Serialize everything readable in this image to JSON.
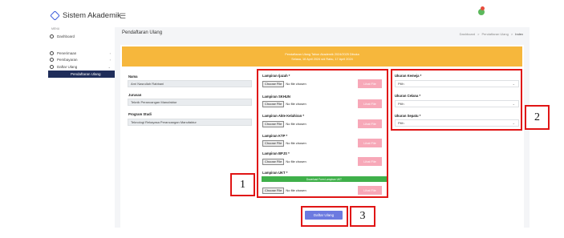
{
  "app": {
    "name": "Sistem Akademik"
  },
  "sidebar": {
    "section_label": "MENU",
    "items": [
      {
        "label": "Dashboard"
      },
      {
        "label": "Penerimaan"
      },
      {
        "label": "Pembayaran"
      },
      {
        "label": "Daftar Ulang"
      }
    ],
    "active_sub": "Pendaftaran Ulang"
  },
  "page": {
    "title": "Pendaftaran Ulang",
    "breadcrumb": [
      "Dashboard",
      ">",
      "Pendaftaran Ulang",
      ">",
      "Index"
    ]
  },
  "banner": {
    "line1": "Pendaftaran Ulang Tahun Akademik 2024/2025 Dibuka",
    "line2": "Selasa, 16 April 2024 s/d Rabu, 17 April 2024"
  },
  "student": {
    "nama_label": "Nama",
    "nama_value": "Arni Nasrullah Rabbani",
    "jurusan_label": "Jurusan",
    "jurusan_value": "Teknik Perancangan Manufaktur",
    "prodi_label": "Program Studi",
    "prodi_value": "Teknologi Rekayasa Perancangan Manufaktur"
  },
  "uploads": {
    "choose_label": "Choose File",
    "no_file": "No file chosen",
    "view_label": "Lihat File",
    "download_label": "Download Form Lampiran UKT",
    "items": [
      {
        "label": "Lampiran Ijazah *"
      },
      {
        "label": "Lampiran SKHUN"
      },
      {
        "label": "Lampiran Akte Kelahiran *"
      },
      {
        "label": "Lampiran KTP *"
      },
      {
        "label": "Lampiran BPJS *"
      },
      {
        "label": "Lampiran UKT *"
      }
    ]
  },
  "sizes": {
    "kemeja_label": "Ukuran Kemeja *",
    "kemeja_value": "Pilih",
    "celana_label": "Ukuran Celana *",
    "celana_value": "Pilih",
    "sepatu_label": "Ukuran Sepatu *",
    "sepatu_value": "Pilih"
  },
  "submit_label": "Daftar Ulang",
  "annotations": {
    "one": "1",
    "two": "2",
    "three": "3"
  },
  "colors": {
    "banner": "#f6b73c",
    "sidebar_active": "#1f2d5a",
    "submit": "#6c7ae0",
    "download": "#3fb04a",
    "annotation": "#e01515"
  }
}
